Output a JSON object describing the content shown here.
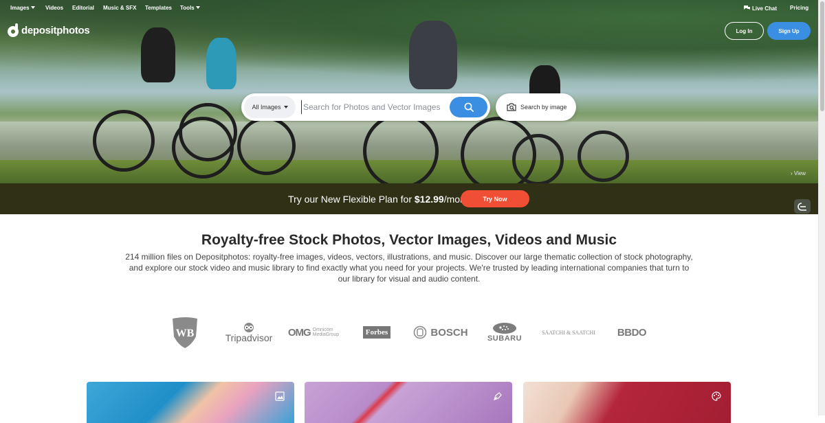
{
  "nav": {
    "items": [
      {
        "label": "Images",
        "has_caret": true
      },
      {
        "label": "Videos",
        "has_caret": false
      },
      {
        "label": "Editorial",
        "has_caret": false
      },
      {
        "label": "Music & SFX",
        "has_caret": false
      },
      {
        "label": "Templates",
        "has_caret": false
      },
      {
        "label": "Tools",
        "has_caret": true
      }
    ],
    "live_chat": "Live Chat",
    "pricing": "Pricing"
  },
  "brand": {
    "name": "depositphotos",
    "accent": "#3b8fe2"
  },
  "auth": {
    "login": "Log In",
    "signup": "Sign Up"
  },
  "search": {
    "category": "All Images",
    "placeholder": "Search for Photos and Vector Images",
    "value": "",
    "search_by_image": "Search by image",
    "icon": "search-icon"
  },
  "hero": {
    "view_link": "View"
  },
  "promo": {
    "text_before": "Try our New Flexible Plan for ",
    "price": "$12.99",
    "text_after": "/month",
    "button": "Try Now",
    "button_color": "#f04f36",
    "background": "#2f3015"
  },
  "main": {
    "headline": "Royalty-free Stock Photos, Vector Images, Videos and Music",
    "description": "214 million files on Depositphotos: royalty-free images, videos, vectors, illustrations, and music. Discover our large thematic collection of stock photography, and explore our stock video and music library to find exactly what you need for your projects. We're trusted by leading international companies that turn to our library for visual and audio content."
  },
  "partners": [
    {
      "name": "Warner Bros",
      "label": ""
    },
    {
      "name": "Tripadvisor",
      "label": "Tripadvisor"
    },
    {
      "name": "Omnicom",
      "label": "OMG",
      "sub": "Omnicom",
      "sub2": "MediaGroup"
    },
    {
      "name": "Forbes",
      "label": "Forbes"
    },
    {
      "name": "Bosch",
      "label": "BOSCH"
    },
    {
      "name": "Subaru",
      "label": "SUBARU"
    },
    {
      "name": "Saatchi & Saatchi",
      "label": "SAATCHI & SAATCHI"
    },
    {
      "name": "BBDO",
      "label": "BBDO"
    }
  ],
  "cards": [
    {
      "icon": "image-icon"
    },
    {
      "icon": "pen-icon"
    },
    {
      "icon": "palette-icon"
    }
  ]
}
